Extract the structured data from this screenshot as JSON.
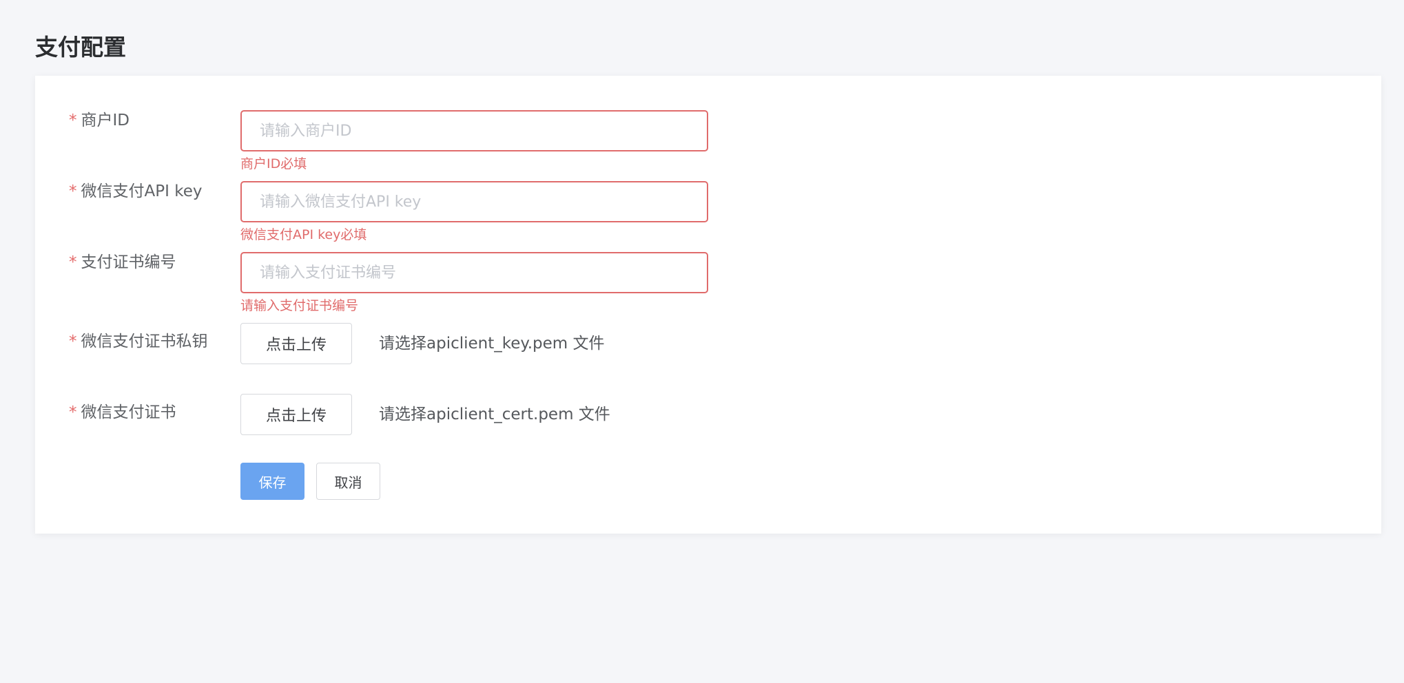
{
  "page": {
    "title": "支付配置"
  },
  "colors": {
    "background": "#f5f6f9",
    "card": "#ffffff",
    "error": "#e06b6b",
    "primary": "#6aa4f0"
  },
  "form": {
    "required_mark": "*",
    "merchant_id": {
      "label": "商户ID",
      "placeholder": "请输入商户ID",
      "value": "",
      "error": "商户ID必填"
    },
    "api_key": {
      "label": "微信支付API key",
      "placeholder": "请输入微信支付API key",
      "value": "",
      "error": "微信支付API key必填"
    },
    "cert_serial": {
      "label": "支付证书编号",
      "placeholder": "请输入支付证书编号",
      "value": "",
      "error": "请输入支付证书编号"
    },
    "private_key": {
      "label": "微信支付证书私钥",
      "upload_label": "点击上传",
      "hint": "请选择apiclient_key.pem 文件"
    },
    "certificate": {
      "label": "微信支付证书",
      "upload_label": "点击上传",
      "hint": "请选择apiclient_cert.pem 文件"
    },
    "actions": {
      "save_label": "保存",
      "cancel_label": "取消"
    }
  }
}
